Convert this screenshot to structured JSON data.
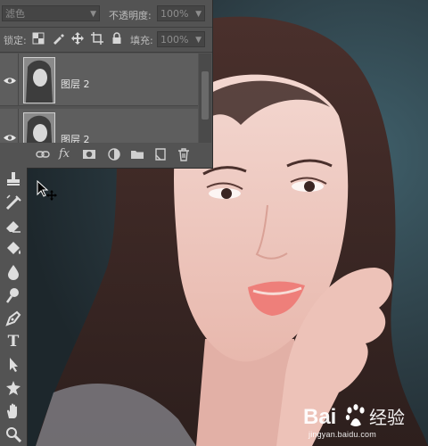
{
  "layers_panel": {
    "blend_mode": "滤色",
    "opacity_label": "不透明度:",
    "opacity_value": "100%",
    "lock_label": "锁定:",
    "fill_label": "填充:",
    "fill_value": "100%",
    "layers": [
      {
        "name": "图层 2",
        "visible": true
      },
      {
        "name": "图层 2",
        "visible": true
      }
    ],
    "footer_icons": [
      "link-icon",
      "fx-icon",
      "mask-icon",
      "adjustment-icon",
      "folder-icon",
      "new-layer-icon",
      "trash-icon"
    ],
    "fx_label": "fx"
  },
  "tools": [
    "stamp-tool-icon",
    "healing-brush-icon",
    "eraser-icon",
    "paint-bucket-icon",
    "blur-drop-icon",
    "dodge-icon",
    "pen-icon",
    "type-tool-icon",
    "path-select-icon",
    "custom-shape-icon",
    "hand-tool-icon",
    "zoom-tool-icon"
  ],
  "type_tool_glyph": "T",
  "watermark": {
    "logo_text": "Bai 经验",
    "url": "jingyan.baidu.com"
  },
  "colors": {
    "panel_bg": "#535353",
    "layer_row_bg": "#5e5e5e",
    "icon": "#d6d6d6",
    "photo_background": "#2f3a40",
    "skin": "#f0c9c1",
    "hair": "#3d2a28",
    "lips": "#ee7f7a"
  }
}
